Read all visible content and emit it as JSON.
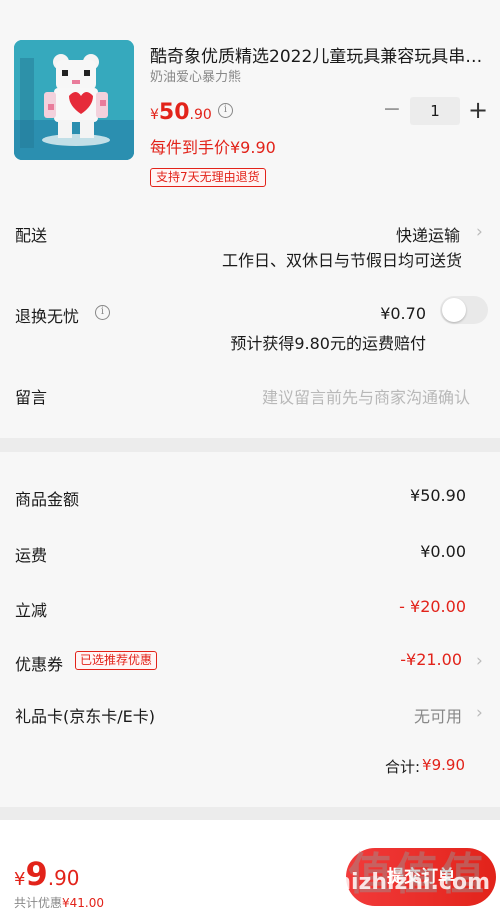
{
  "product": {
    "title": "酷奇象优质精选2022儿童玩具兼容玩具串…",
    "subtitle": "奶油爱心暴力熊",
    "price_currency": "¥",
    "price_int": "50",
    "price_dec": ".90",
    "quantity": "1",
    "minus_label": "−",
    "plus_label": "+",
    "deal_price": "每件到手价¥9.90",
    "return_badge": "支持7天无理由退货"
  },
  "delivery": {
    "label": "配送",
    "method": "快递运输",
    "schedule": "工作日、双休日与节假日均可送货"
  },
  "return_insurance": {
    "label": "退换无忧",
    "price": "¥0.70",
    "note": "预计获得9.80元的运费赔付",
    "enabled": false
  },
  "message": {
    "label": "留言",
    "placeholder": "建议留言前先与商家沟通确认"
  },
  "summary": {
    "goods_label": "商品金额",
    "goods_value": "¥50.90",
    "shipping_label": "运费",
    "shipping_value": "¥0.00",
    "instant_label": "立减",
    "instant_value": "- ¥20.00",
    "coupon_label": "优惠券",
    "coupon_badge": "已选推荐优惠",
    "coupon_value": "-¥21.00",
    "giftcard_label": "礼品卡(京东卡/E卡)",
    "giftcard_value": "无可用",
    "total_label": "合计:",
    "total_value": "¥9.90"
  },
  "bottom": {
    "currency": "¥",
    "price_int": "9",
    "price_dec": ".90",
    "discount_label": "共计优惠",
    "discount_value": "¥41.00",
    "submit_label": "提交订单",
    "watermark": "值值值",
    "watermark_url": "zhizhizhi.com"
  },
  "colors": {
    "accent": "#e2231a",
    "background": "#f7f7f7"
  }
}
